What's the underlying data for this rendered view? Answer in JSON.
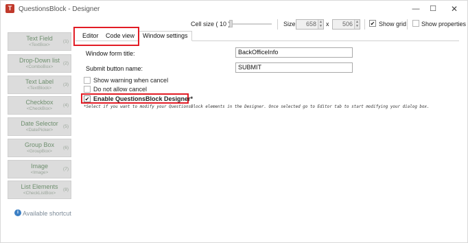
{
  "window": {
    "title": "QuestionsBlock - Designer",
    "app_icon_glyph": "T",
    "minimize_glyph": "—",
    "maximize_glyph": "☐",
    "close_glyph": "✕"
  },
  "toolbar": {
    "cell_size_label": "Cell size ( 10 )",
    "size_label": "Size:",
    "width_value": "658",
    "x_label": "x",
    "height_value": "506",
    "show_grid_label": "Show grid",
    "show_grid_checked": true,
    "show_properties_label": "Show properties",
    "show_properties_checked": false
  },
  "left_panel": {
    "items": [
      {
        "name": "Text Field",
        "type": "<TextBox>",
        "shortcut": "(1)"
      },
      {
        "name": "Drop-Down list",
        "type": "<ComboBox>",
        "shortcut": "(2)"
      },
      {
        "name": "Text Label",
        "type": "<TextBlock>",
        "shortcut": "(3)"
      },
      {
        "name": "Checkbox",
        "type": "<CheckBox>",
        "shortcut": "(4)"
      },
      {
        "name": "Date Selector",
        "type": "<DatePicker>",
        "shortcut": "(5)"
      },
      {
        "name": "Group Box",
        "type": "<GroupBox>",
        "shortcut": "(6)"
      },
      {
        "name": "Image",
        "type": "<Image>",
        "shortcut": "(7)"
      },
      {
        "name": "List Elements",
        "type": "<CheckListBox>",
        "shortcut": "(8)"
      }
    ],
    "shortcut_hint": "Available shortcut",
    "info_glyph": "i"
  },
  "tabs": [
    {
      "label": "Editor"
    },
    {
      "label": "Code view"
    },
    {
      "label": "Window settings",
      "active": true
    }
  ],
  "settings": {
    "form_title_label": "Window form title:",
    "form_title_value": "BackOfficeInfo",
    "submit_label": "Submit button name:",
    "submit_value": "SUBMIT",
    "show_warning_label": "Show warning when cancel",
    "show_warning_checked": false,
    "no_cancel_label": "Do not allow cancel",
    "no_cancel_checked": false,
    "enable_designer_label": "Enable QuestionsBlock Designer*",
    "enable_designer_checked": true,
    "hint": "*Select if you want to modify your QuestionsBlock elements in the Designer. Once selected go to Editor tab to start modifying your dialog box."
  },
  "colors": {
    "highlight_red": "#e21b24",
    "panel_button_bg": "#dcdcdc",
    "panel_text_green": "#6f8f6f"
  }
}
